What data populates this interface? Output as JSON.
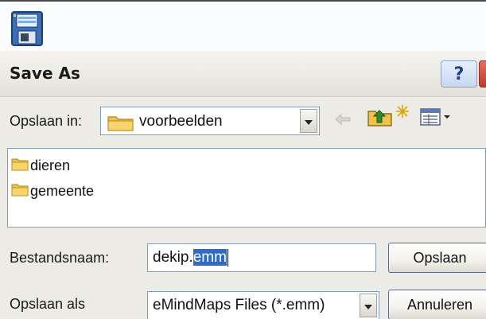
{
  "window": {
    "title": "Save As"
  },
  "toolbar": {
    "save_icon": "floppy-disk-icon",
    "help_label": "?"
  },
  "location": {
    "label": "Opslaan in:",
    "folder": "voorbeelden",
    "folder_icon": "folder-icon",
    "back_icon": "back-arrow-icon",
    "up_icon": "up-folder-icon",
    "new_icon": "new-folder-icon",
    "view_icon": "view-menu-icon"
  },
  "files": [
    {
      "name": "dieren",
      "icon": "folder-icon"
    },
    {
      "name": "gemeente",
      "icon": "folder-icon"
    }
  ],
  "filename": {
    "label": "Bestandsnaam:",
    "value_base": "dekip.",
    "value_ext": "emm"
  },
  "filetype": {
    "label": "Opslaan als",
    "selected": "eMindMaps Files (*.emm)"
  },
  "buttons": {
    "save": "Opslaan",
    "cancel": "Annuleren"
  },
  "colors": {
    "titlebar": "#ecebe4",
    "dialog": "#ecebe5",
    "selection": "#316ac5",
    "folder": "#f2c14a"
  }
}
